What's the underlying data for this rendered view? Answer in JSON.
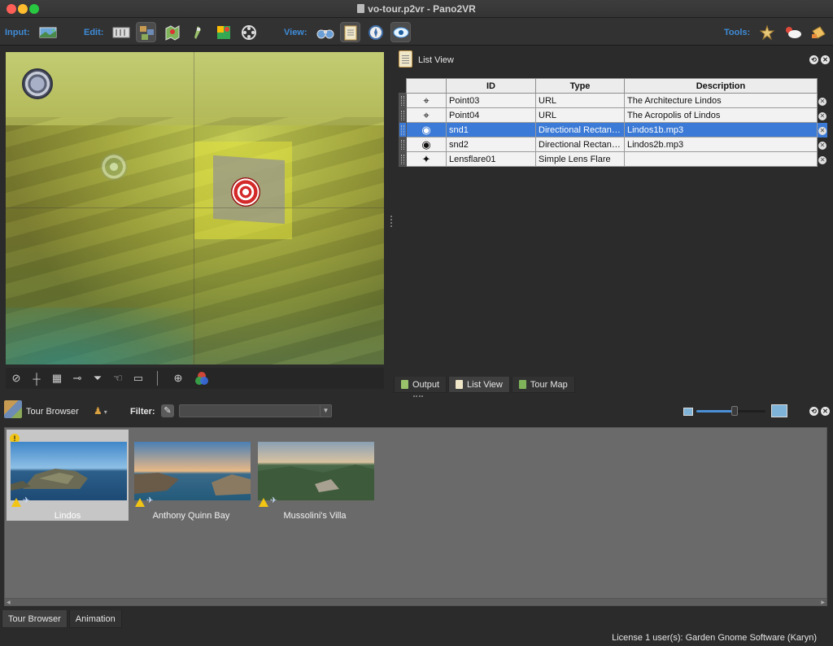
{
  "window": {
    "title": "vo-tour.p2vr - Pano2VR"
  },
  "toolbar": {
    "input_label": "Input:",
    "edit_label": "Edit:",
    "view_label": "View:",
    "tools_label": "Tools:"
  },
  "list_view": {
    "title": "List View",
    "columns": [
      "ID",
      "Type",
      "Description"
    ],
    "rows": [
      {
        "icon": "⌖",
        "id": "Point03",
        "type": "URL",
        "description": "The Architecture Lindos",
        "selected": false
      },
      {
        "icon": "⌖",
        "id": "Point04",
        "type": "URL",
        "description": "The Acropolis of Lindos",
        "selected": false
      },
      {
        "icon": "◉",
        "id": "snd1",
        "type": "Directional Rectang...",
        "description": "Lindos1b.mp3",
        "selected": true
      },
      {
        "icon": "◉",
        "id": "snd2",
        "type": "Directional Rectang...",
        "description": "Lindos2b.mp3",
        "selected": false
      },
      {
        "icon": "✦",
        "id": "Lensflare01",
        "type": "Simple Lens Flare",
        "description": "",
        "selected": false
      }
    ]
  },
  "right_tabs": [
    "Output",
    "List View",
    "Tour Map"
  ],
  "tour_browser": {
    "title": "Tour Browser",
    "filter_label": "Filter:",
    "filter_value": "",
    "zoom_level": 0.55,
    "nodes": [
      {
        "label": "Lindos",
        "selected": true
      },
      {
        "label": "Anthony Quinn Bay",
        "selected": false
      },
      {
        "label": "Mussolini's Villa",
        "selected": false
      }
    ]
  },
  "bottom_tabs": [
    "Tour Browser",
    "Animation"
  ],
  "status": "License 1 user(s): Garden Gnome Software (Karyn)",
  "colors": {
    "accent": "#3f8cd8",
    "selection": "#3b7ad6",
    "warning": "#f2c413"
  }
}
